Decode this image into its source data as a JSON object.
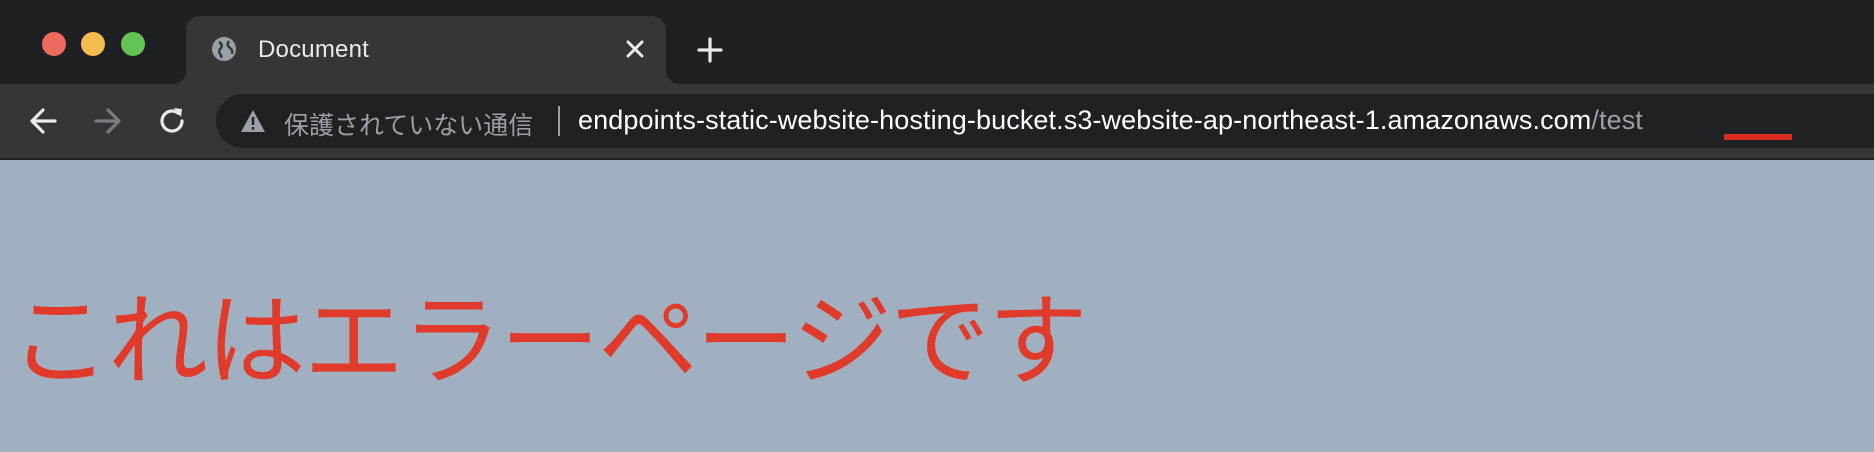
{
  "tab": {
    "title": "Document",
    "favicon": "globe-icon"
  },
  "toolbar": {
    "back_icon": "arrow-left-icon",
    "forward_icon": "arrow-right-icon",
    "reload_icon": "reload-icon"
  },
  "omnibox": {
    "security_label": "保護されていない通信",
    "url_host": "endpoints-static-website-hosting-bucket.s3-website-ap-northeast-1.amazonaws.com",
    "url_path": "/test"
  },
  "page": {
    "heading": "これはエラーページです"
  },
  "colors": {
    "page_background": "#a0b0c0",
    "heading_color": "#e03a2b",
    "annotation_underline": "#d62d20"
  }
}
